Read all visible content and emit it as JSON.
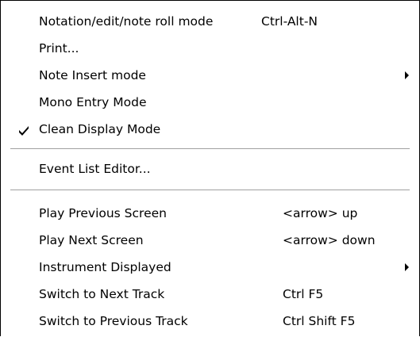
{
  "menu": {
    "items": [
      {
        "label": "Notation/edit/note roll mode",
        "shortcut": "Ctrl-Alt-N"
      },
      {
        "label": "Print..."
      },
      {
        "label": "Note Insert mode",
        "submenu": true
      },
      {
        "label": "Mono Entry Mode"
      },
      {
        "label": "Clean Display Mode",
        "checked": true
      },
      {
        "label": "Event List Editor..."
      },
      {
        "label": "Play Previous Screen",
        "shortcut": "<arrow> up"
      },
      {
        "label": "Play Next Screen",
        "shortcut": "<arrow> down"
      },
      {
        "label": "Instrument Displayed",
        "submenu": true
      },
      {
        "label": "Switch to Next Track",
        "shortcut": "Ctrl F5"
      },
      {
        "label": "Switch to Previous Track",
        "shortcut": "Ctrl Shift F5"
      }
    ],
    "icons": {
      "check": "checkmark-icon",
      "submenu": "triangle-right-icon"
    }
  }
}
